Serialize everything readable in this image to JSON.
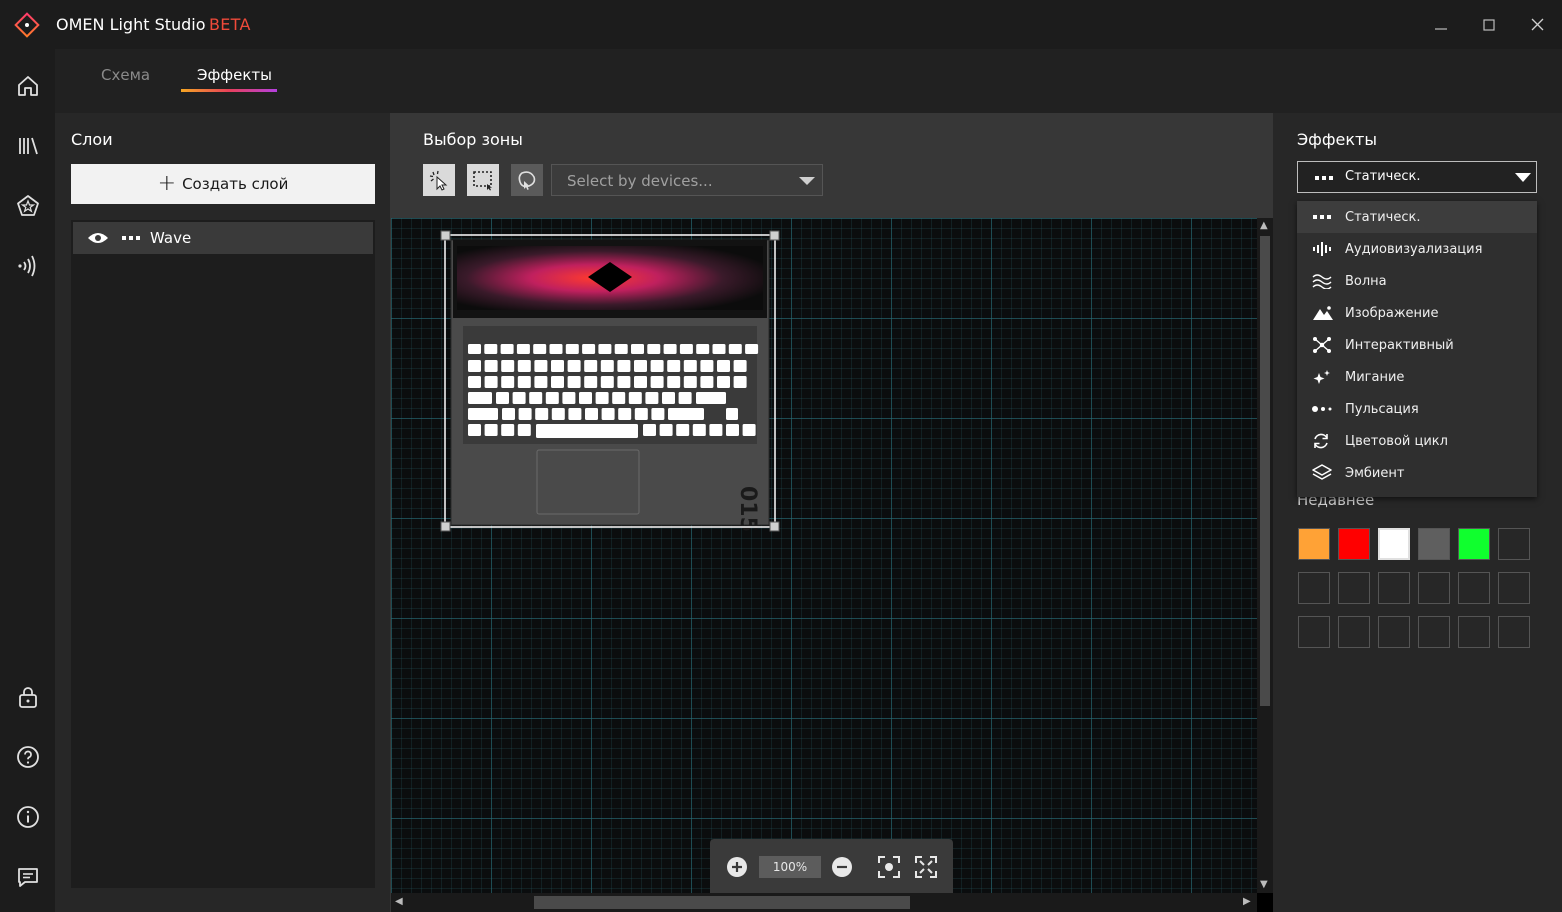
{
  "app": {
    "title": "OMEN Light Studio",
    "badge": "BETA",
    "window_controls": [
      "minimize-icon",
      "maximize-icon",
      "close-icon"
    ]
  },
  "nav": {
    "items": [
      {
        "icon": "home-icon"
      },
      {
        "icon": "library-icon"
      },
      {
        "icon": "pentagon-star-icon"
      },
      {
        "icon": "signal-waves-icon"
      },
      {
        "icon": "lock-icon"
      },
      {
        "icon": "help-icon"
      },
      {
        "icon": "info-icon"
      },
      {
        "icon": "feedback-icon"
      }
    ]
  },
  "tabs": [
    {
      "label": "Схема",
      "active": false
    },
    {
      "label": "Эффекты",
      "active": true
    }
  ],
  "layers": {
    "title": "Слои",
    "create_label": "Создать слой",
    "items": [
      {
        "name": "Wave",
        "visible": true
      }
    ]
  },
  "zone": {
    "title": "Выбор зоны",
    "tools": [
      "pointer-select-icon",
      "rectangle-select-icon",
      "lasso-select-icon"
    ],
    "device_select_placeholder": "Select by devices...",
    "zoom": "100%"
  },
  "effects": {
    "title": "Эффекты",
    "selected": "Статическ.",
    "options": [
      {
        "label": "Статическ.",
        "icon": "static-dots-icon"
      },
      {
        "label": "Аудиовизуализация",
        "icon": "audio-bars-icon"
      },
      {
        "label": "Волна",
        "icon": "wave-icon"
      },
      {
        "label": "Изображение",
        "icon": "image-mountain-icon"
      },
      {
        "label": "Интерактивный",
        "icon": "interactive-icon"
      },
      {
        "label": "Мигание",
        "icon": "sparkle-icon"
      },
      {
        "label": "Пульсация",
        "icon": "pulse-dots-icon"
      },
      {
        "label": "Цветовой цикл",
        "icon": "color-cycle-icon"
      },
      {
        "label": "Эмбиент",
        "icon": "ambient-layers-icon"
      }
    ],
    "recent_title": "Недавнее",
    "recent_colors": [
      "#FFA236",
      "#FF0000",
      "#FFFFFF",
      "#5F5F5F",
      "#10FF2E",
      "",
      "",
      "",
      "",
      "",
      "",
      "",
      "",
      "",
      "",
      "",
      "",
      ""
    ]
  },
  "colors": {
    "accent_red": "#F04A3A",
    "tab_gradient": [
      "#F5A623",
      "#E8405A",
      "#B440E0"
    ]
  }
}
